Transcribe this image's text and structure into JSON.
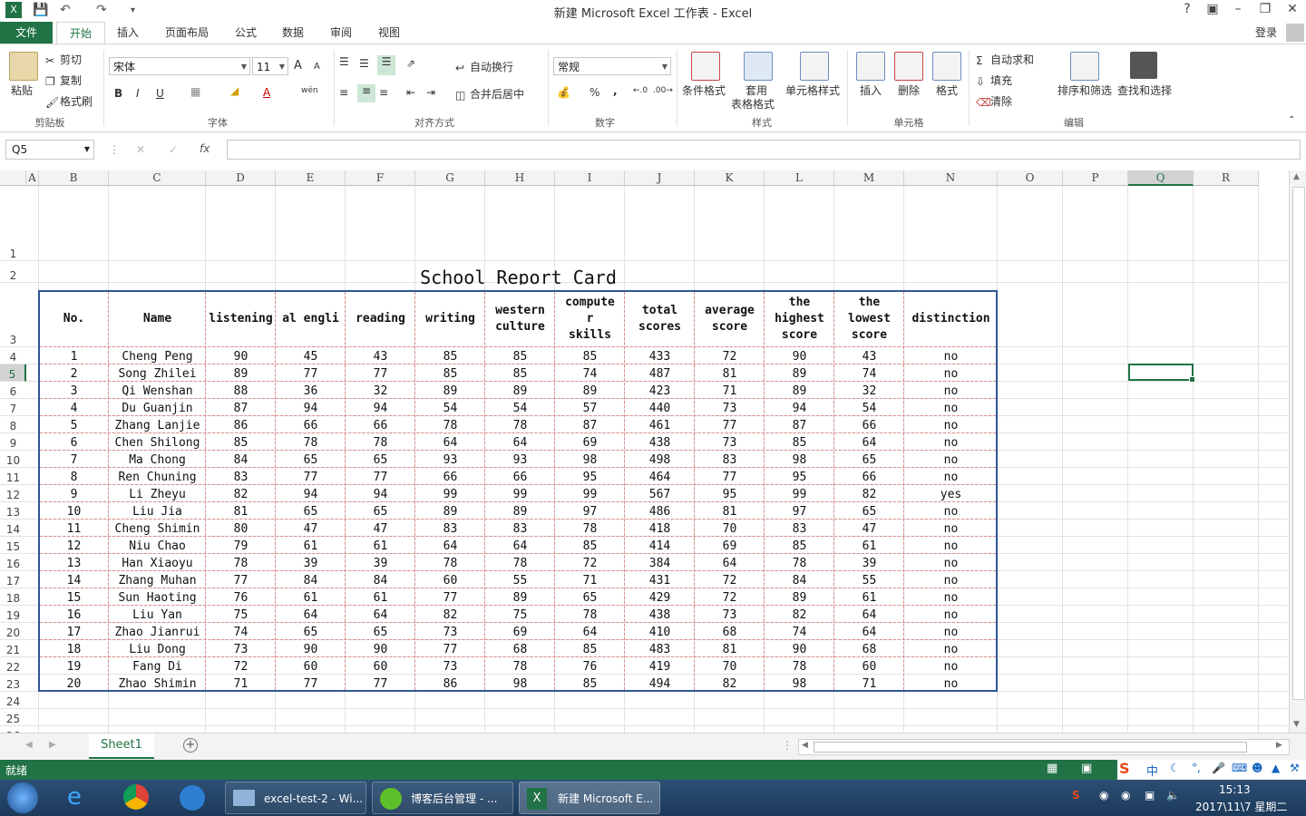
{
  "window": {
    "title": "新建 Microsoft Excel 工作表 - Excel",
    "help": "?",
    "login": "登录"
  },
  "tabs": [
    "文件",
    "开始",
    "插入",
    "页面布局",
    "公式",
    "数据",
    "审阅",
    "视图"
  ],
  "ribbon": {
    "clipboard": {
      "paste": "粘贴",
      "cut": "剪切",
      "copy": "复制",
      "format_painter": "格式刷",
      "label": "剪贴板"
    },
    "font": {
      "name": "宋体",
      "size": "11",
      "label": "字体",
      "bold": "B",
      "italic": "I",
      "underline": "U",
      "grow": "A",
      "shrink": "A",
      "color": "A",
      "wen": "wén"
    },
    "alignment": {
      "wrap": "自动换行",
      "merge": "合并后居中",
      "label": "对齐方式"
    },
    "number": {
      "format": "常规",
      "label": "数字",
      "percent": "%",
      "comma": ","
    },
    "styles": {
      "conditional": "条件格式",
      "table1": "套用",
      "table2": "表格格式",
      "cell_styles": "单元格样式",
      "label": "样式"
    },
    "cells": {
      "insert": "插入",
      "delete": "删除",
      "format": "格式",
      "label": "单元格"
    },
    "editing": {
      "autosum": "自动求和",
      "fill": "填充",
      "clear": "清除",
      "sort": "排序和筛选",
      "find": "查找和选择",
      "label": "编辑"
    }
  },
  "formula_bar": {
    "name_box": "Q5",
    "fx": "fx",
    "value": ""
  },
  "columns": [
    "A",
    "B",
    "C",
    "D",
    "E",
    "F",
    "G",
    "H",
    "I",
    "J",
    "K",
    "L",
    "M",
    "N",
    "O",
    "P",
    "Q",
    "R"
  ],
  "rows": [
    "1",
    "2",
    "3",
    "4",
    "5",
    "6",
    "7",
    "8",
    "9",
    "10",
    "11",
    "12",
    "13",
    "14",
    "15",
    "16",
    "17",
    "18",
    "19",
    "20",
    "21",
    "22",
    "23",
    "24",
    "25",
    "26"
  ],
  "report": {
    "title": "School Report Card",
    "headers": [
      [
        "No."
      ],
      [
        "Name"
      ],
      [
        "listening"
      ],
      [
        "al engli"
      ],
      [
        "reading"
      ],
      [
        "writing"
      ],
      [
        "western",
        "culture"
      ],
      [
        "compute",
        "r",
        "skills"
      ],
      [
        "total",
        "scores"
      ],
      [
        "average",
        "score"
      ],
      [
        "the",
        "highest",
        "score"
      ],
      [
        "the",
        "lowest",
        "score"
      ],
      [
        "distinction"
      ]
    ],
    "rows": [
      [
        "1",
        "Cheng Peng",
        "90",
        "45",
        "43",
        "85",
        "85",
        "85",
        "433",
        "72",
        "90",
        "43",
        "no"
      ],
      [
        "2",
        "Song Zhilei",
        "89",
        "77",
        "77",
        "85",
        "85",
        "74",
        "487",
        "81",
        "89",
        "74",
        "no"
      ],
      [
        "3",
        "Qi Wenshan",
        "88",
        "36",
        "32",
        "89",
        "89",
        "89",
        "423",
        "71",
        "89",
        "32",
        "no"
      ],
      [
        "4",
        "Du Guanjin",
        "87",
        "94",
        "94",
        "54",
        "54",
        "57",
        "440",
        "73",
        "94",
        "54",
        "no"
      ],
      [
        "5",
        "Zhang Lanjie",
        "86",
        "66",
        "66",
        "78",
        "78",
        "87",
        "461",
        "77",
        "87",
        "66",
        "no"
      ],
      [
        "6",
        "Chen Shilong",
        "85",
        "78",
        "78",
        "64",
        "64",
        "69",
        "438",
        "73",
        "85",
        "64",
        "no"
      ],
      [
        "7",
        "Ma Chong",
        "84",
        "65",
        "65",
        "93",
        "93",
        "98",
        "498",
        "83",
        "98",
        "65",
        "no"
      ],
      [
        "8",
        "Ren Chuning",
        "83",
        "77",
        "77",
        "66",
        "66",
        "95",
        "464",
        "77",
        "95",
        "66",
        "no"
      ],
      [
        "9",
        "Li Zheyu",
        "82",
        "94",
        "94",
        "99",
        "99",
        "99",
        "567",
        "95",
        "99",
        "82",
        "yes"
      ],
      [
        "10",
        "Liu Jia",
        "81",
        "65",
        "65",
        "89",
        "89",
        "97",
        "486",
        "81",
        "97",
        "65",
        "no"
      ],
      [
        "11",
        "Cheng Shimin",
        "80",
        "47",
        "47",
        "83",
        "83",
        "78",
        "418",
        "70",
        "83",
        "47",
        "no"
      ],
      [
        "12",
        "Niu Chao",
        "79",
        "61",
        "61",
        "64",
        "64",
        "85",
        "414",
        "69",
        "85",
        "61",
        "no"
      ],
      [
        "13",
        "Han Xiaoyu",
        "78",
        "39",
        "39",
        "78",
        "78",
        "72",
        "384",
        "64",
        "78",
        "39",
        "no"
      ],
      [
        "14",
        "Zhang Muhan",
        "77",
        "84",
        "84",
        "60",
        "55",
        "71",
        "431",
        "72",
        "84",
        "55",
        "no"
      ],
      [
        "15",
        "Sun Haoting",
        "76",
        "61",
        "61",
        "77",
        "89",
        "65",
        "429",
        "72",
        "89",
        "61",
        "no"
      ],
      [
        "16",
        "Liu Yan",
        "75",
        "64",
        "64",
        "82",
        "75",
        "78",
        "438",
        "73",
        "82",
        "64",
        "no"
      ],
      [
        "17",
        "Zhao Jianrui",
        "74",
        "65",
        "65",
        "73",
        "69",
        "64",
        "410",
        "68",
        "74",
        "64",
        "no"
      ],
      [
        "18",
        "Liu Dong",
        "73",
        "90",
        "90",
        "77",
        "68",
        "85",
        "483",
        "81",
        "90",
        "68",
        "no"
      ],
      [
        "19",
        "Fang Di",
        "72",
        "60",
        "60",
        "73",
        "78",
        "76",
        "419",
        "70",
        "78",
        "60",
        "no"
      ],
      [
        "20",
        "Zhao Shimin",
        "71",
        "77",
        "77",
        "86",
        "98",
        "85",
        "494",
        "82",
        "98",
        "71",
        "no"
      ]
    ]
  },
  "sheet_tab": "Sheet1",
  "status": {
    "ready": "就绪"
  },
  "taskbar": {
    "items": [
      "excel-test-2 - Wi...",
      "博客后台管理 - ...",
      "新建 Microsoft E..."
    ],
    "time": "15:13",
    "date": "2017\\11\\7 星期二",
    "ime": "中"
  },
  "colors": {
    "excel_green": "#217346",
    "selected": "#217346"
  }
}
